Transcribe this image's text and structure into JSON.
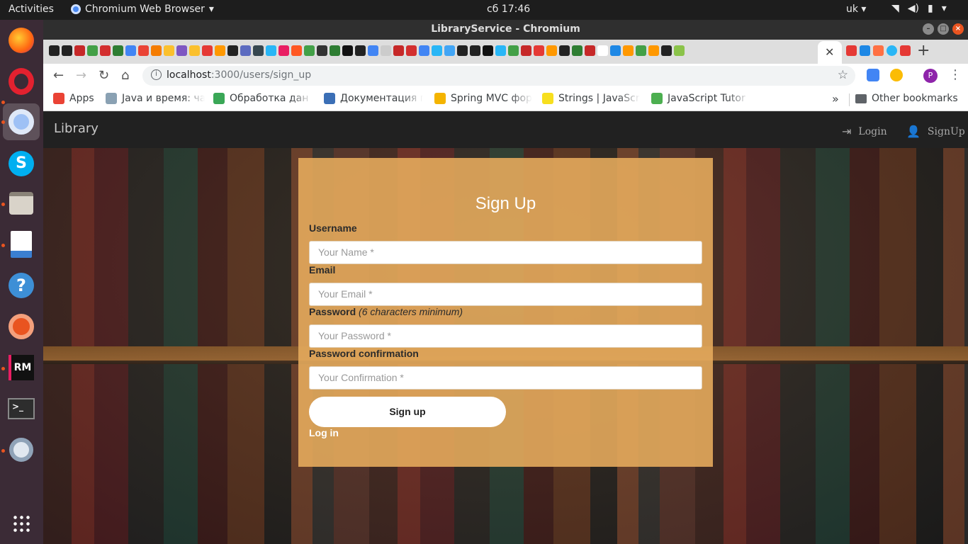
{
  "system_bar": {
    "activities": "Activities",
    "app_name": "Chromium Web Browser",
    "clock": "сб 17:46",
    "keyboard_layout": "uk"
  },
  "window": {
    "title": "LibraryService - Chromium"
  },
  "browser": {
    "url_host": "localhost",
    "url_path": ":3000/users/sign_up",
    "profile_initial": "P",
    "bookmarks": [
      {
        "label": "Apps",
        "icon": "apps-grid-icon",
        "color": "#ea4335"
      },
      {
        "label": "Java и время: ча",
        "icon": "h-icon",
        "color": "#8aa1b3"
      },
      {
        "label": "Обработка дан",
        "icon": "spiral-icon",
        "color": "#3aa757"
      },
      {
        "label": "Документация г",
        "icon": "bn-icon",
        "color": "#3b6fb6"
      },
      {
        "label": "Spring MVC фор",
        "icon": "windows-icon",
        "color": "#f4b400"
      },
      {
        "label": "Strings | JavaScr",
        "icon": "js-icon",
        "color": "#f7df1e"
      },
      {
        "label": "JavaScript Tutor",
        "icon": "w3-icon",
        "color": "#4caf50"
      }
    ],
    "other_bookmarks": "Other bookmarks"
  },
  "app": {
    "brand": "Library",
    "nav": {
      "login": "Login",
      "signup": "SignUp"
    }
  },
  "form": {
    "title": "Sign Up",
    "username_label": "Username",
    "username_placeholder": "Your Name *",
    "email_label": "Email",
    "email_placeholder": "Your Email *",
    "password_label": "Password",
    "password_hint": "(6 characters minimum)",
    "password_placeholder": "Your Password *",
    "confirmation_label": "Password confirmation",
    "confirmation_placeholder": "Your Confirmation *",
    "submit": "Sign up",
    "login_link": "Log in"
  },
  "colors": {
    "card": "#e4aa5c",
    "navbar": "#212121",
    "ubuntu_orange": "#e95420"
  }
}
